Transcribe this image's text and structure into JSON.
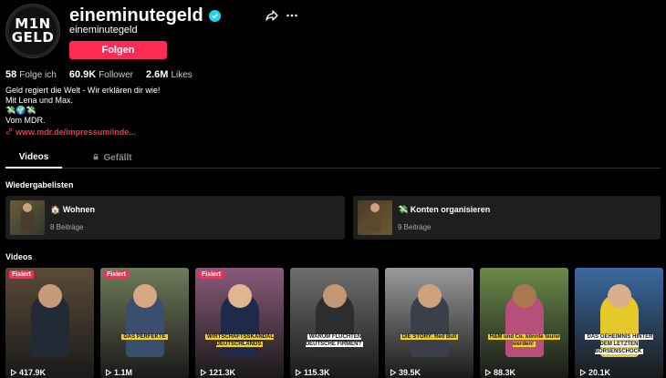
{
  "profile": {
    "avatar_line1": "M1N",
    "avatar_line2": "GELD",
    "username": "eineminutegeld",
    "nickname": "eineminutegeld",
    "follow_label": "Folgen"
  },
  "stats": [
    {
      "value": "58",
      "label": "Folge ich"
    },
    {
      "value": "60.9K",
      "label": "Follower"
    },
    {
      "value": "2.6M",
      "label": "Likes"
    }
  ],
  "bio": {
    "line1": "Geld regiert die Welt - Wir erklären dir wie!",
    "line2": "Mit Lena und Max.",
    "line3": "💸🌍💸",
    "line4": "Vom MDR.",
    "link": "www.mdr.de/impressum/inde..."
  },
  "tabs": [
    {
      "label": "Videos"
    },
    {
      "label": "Gefällt"
    }
  ],
  "playlists_title": "Wiedergabelisten",
  "playlists": [
    {
      "title": "🏠 Wohnen",
      "count": "8 Beiträge"
    },
    {
      "title": "💸 Konten organisieren",
      "count": "9 Beiträge"
    }
  ],
  "videos_title": "Videos",
  "videos": [
    {
      "badge": "Fixiert",
      "caption": "",
      "views": "417.9K",
      "bg": "#5a4a38",
      "skin": "#c79b7a",
      "shirt": "#222a35"
    },
    {
      "badge": "Fixiert",
      "caption": "DAS PERFEKTE",
      "views": "1.1M",
      "bg": "#6f7a5a",
      "skin": "#d8a884",
      "shirt": "#3a4e6d"
    },
    {
      "badge": "Fixiert",
      "caption": "WIRTSCHAFTSSKANDAL DEUTSCHLANDS",
      "views": "121.3K",
      "bg": "#8a5a7a",
      "skin": "#e0b58f",
      "shirt": "#1f2a4a"
    },
    {
      "badge": "",
      "caption": "WARUM FLÜCHTEN DEUTSCHE FIRMEN?",
      "views": "115.3K",
      "bg": "#6e6e6e",
      "skin": "#c39774",
      "shirt": "#2d2d2d"
    },
    {
      "badge": "",
      "caption": "DIE STORY: Red Bull",
      "views": "39.5K",
      "bg": "#9a9a9a",
      "skin": "#cfa07c",
      "shirt": "#3a3f4a"
    },
    {
      "badge": "",
      "caption": "H&M und Co. könnte teurer werden!",
      "views": "88.3K",
      "bg": "#6a8a4a",
      "skin": "#a9784f",
      "shirt": "#b84e7a"
    },
    {
      "badge": "",
      "caption": "DAS GEHEIMNIS HINTER DEM LETZTEN BÖRSENSCHOCK",
      "views": "20.1K",
      "bg": "#3a6aa0",
      "skin": "#d8b08e",
      "shirt": "#e6c82a"
    }
  ]
}
